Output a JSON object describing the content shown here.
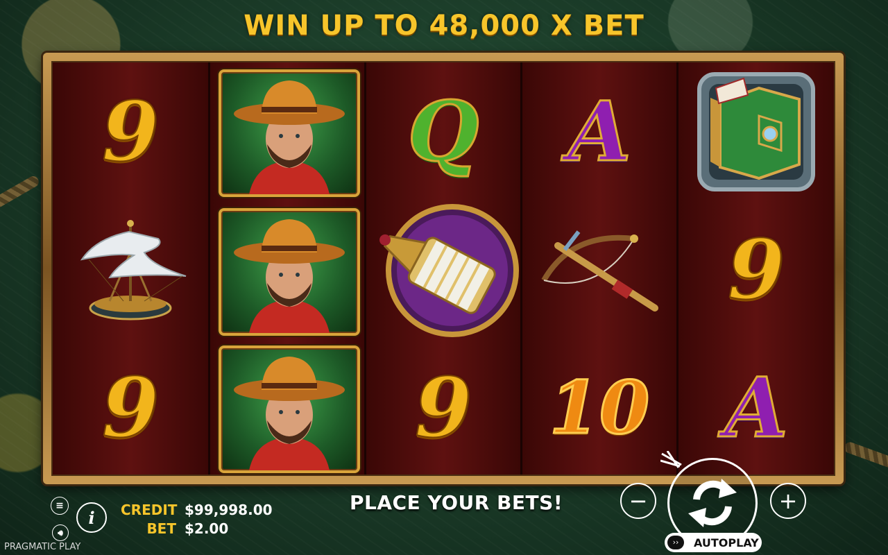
{
  "title": "WIN UP TO 48,000 X BET",
  "reels": [
    {
      "top": "9",
      "middle": "airship-symbol",
      "bottom": "9"
    },
    {
      "top": "explorer-symbol",
      "middle": "explorer-symbol",
      "bottom": "explorer-symbol"
    },
    {
      "top": "Q",
      "middle": "cryptex-symbol",
      "bottom": "9"
    },
    {
      "top": "A",
      "middle": "crossbow-symbol",
      "bottom": "10"
    },
    {
      "top": "book-symbol",
      "middle": "9",
      "bottom": "A"
    }
  ],
  "labels": {
    "r0_top": "9",
    "r0_bottom": "9",
    "r2_top": "Q",
    "r2_bottom": "9",
    "r3_top": "A",
    "r3_bottom": "10",
    "r4_middle": "9",
    "r4_bottom": "A"
  },
  "status": {
    "message": "PLACE YOUR BETS!"
  },
  "credit": {
    "label": "CREDIT",
    "value": "$99,998.00"
  },
  "bet": {
    "label": "BET",
    "value": "$2.00"
  },
  "controls": {
    "menu_icon": "menu-icon",
    "info_label": "i",
    "sound_icon": "speaker-icon",
    "minus_label": "−",
    "plus_label": "+",
    "autoplay_label": "AUTOPLAY"
  },
  "brand": "PRAGMATIC PLAY",
  "colors": {
    "gold": "#f7c52b",
    "reel_red": "#5e1110",
    "frame": "#c89a52"
  }
}
